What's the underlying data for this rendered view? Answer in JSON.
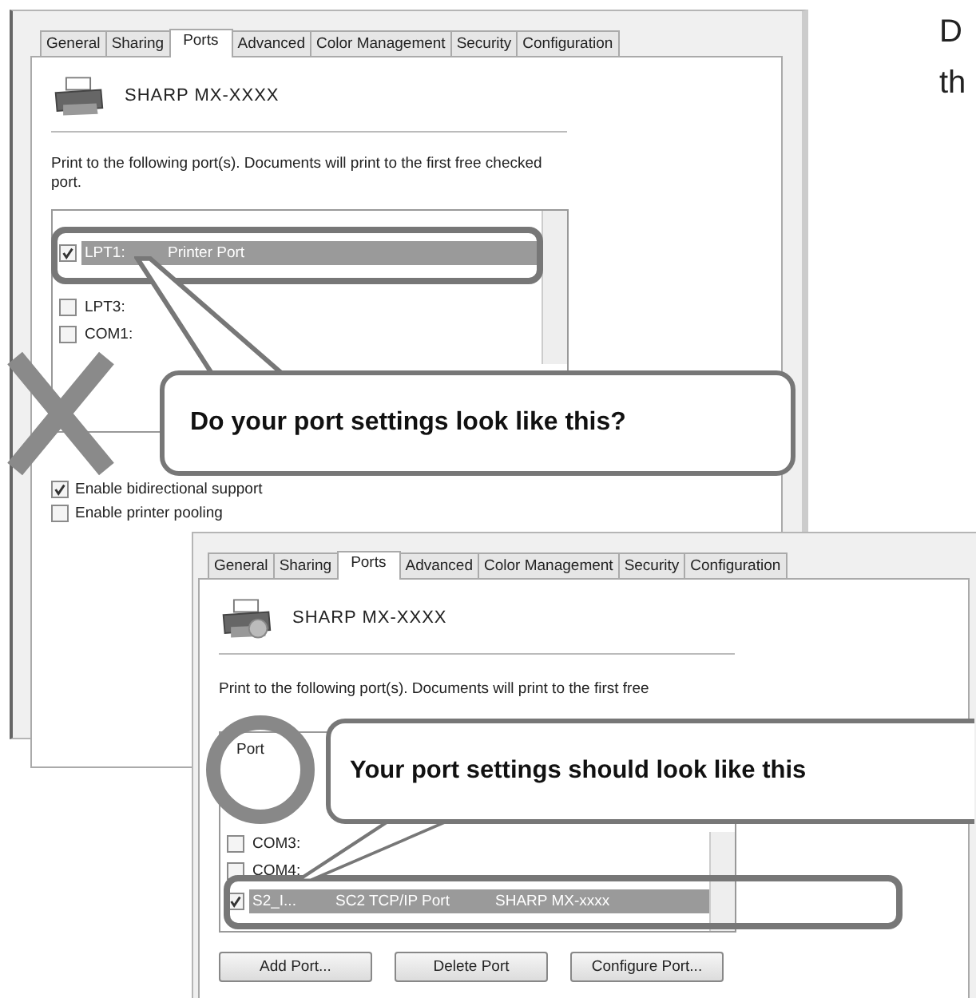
{
  "dialogs": [
    {
      "tabs": [
        {
          "label": "General",
          "selected": false
        },
        {
          "label": "Sharing",
          "selected": false
        },
        {
          "label": "Ports",
          "selected": true
        },
        {
          "label": "Advanced",
          "selected": false
        },
        {
          "label": "Color Management",
          "selected": false
        },
        {
          "label": "Security",
          "selected": false
        },
        {
          "label": "Configuration",
          "selected": false
        }
      ],
      "printer_name": "SHARP MX-XXXX",
      "description": "Print to the following port(s). Documents will print to the first free checked port.",
      "port_list": {
        "rows": [
          {
            "port": "LPT1:",
            "description": "Printer Port",
            "checked": true,
            "selected": true
          },
          {
            "port": "LPT3:",
            "checked": false,
            "selected": false
          },
          {
            "port": "COM1:",
            "checked": false,
            "selected": false
          }
        ]
      },
      "options": [
        {
          "label": "Enable bidirectional support",
          "checked": true
        },
        {
          "label": "Enable printer pooling",
          "checked": false
        }
      ]
    },
    {
      "tabs": [
        {
          "label": "General",
          "selected": false
        },
        {
          "label": "Sharing",
          "selected": false
        },
        {
          "label": "Ports",
          "selected": true
        },
        {
          "label": "Advanced",
          "selected": false
        },
        {
          "label": "Color Management",
          "selected": false
        },
        {
          "label": "Security",
          "selected": false
        },
        {
          "label": "Configuration",
          "selected": false
        }
      ],
      "printer_name": "SHARP MX-XXXX",
      "description": "Print to the following port(s). Documents will print to the first free",
      "port_list": {
        "columns": [
          "Port"
        ],
        "rows": [
          {
            "port": "COM3:",
            "checked": false,
            "selected": false
          },
          {
            "port": "COM4:",
            "checked": false,
            "selected": false
          },
          {
            "port": "S2_I...",
            "description": "SC2 TCP/IP Port",
            "printer": "SHARP MX-xxxx",
            "checked": true,
            "selected": true
          }
        ]
      },
      "buttons": [
        "Add Port...",
        "Delete Port",
        "Configure Port..."
      ]
    }
  ],
  "callouts": [
    {
      "kind": "wrong",
      "text": "Do your port settings look like this?"
    },
    {
      "kind": "right",
      "text": "Your port settings should look like this"
    }
  ],
  "page_text": [
    "D",
    "th"
  ]
}
